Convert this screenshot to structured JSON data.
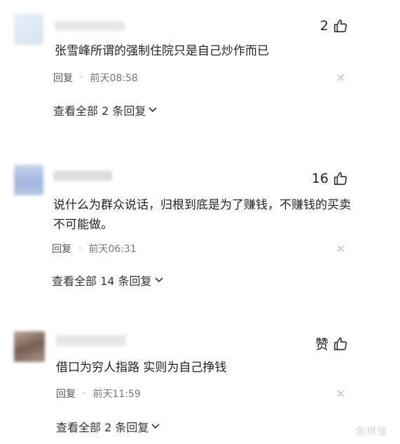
{
  "comments": [
    {
      "likes": "2",
      "text": "张雪峰所谓的强制住院只是自己炒作而已",
      "reply_label": "回复",
      "dot": "·",
      "time": "前天08:58",
      "close_glyph": "×",
      "more_label": "查看全部 2 条回复"
    },
    {
      "likes": "16",
      "text": "说什么为群众说话，归根到底是为了赚钱，不赚钱的买卖不可能做。",
      "reply_label": "回复",
      "dot": "·",
      "time": "前天06:31",
      "close_glyph": "×",
      "more_label": "查看全部 14 条回复"
    },
    {
      "likes": "赞",
      "text": "借口为穷人指路 实则为自己挣钱",
      "reply_label": "回复",
      "dot": "·",
      "time": "前天11:59",
      "close_glyph": "×",
      "more_label": "查看全部 2 条回复"
    }
  ],
  "icons": {
    "like": "thumbs-up-icon",
    "close": "close-icon",
    "expand": "chevron-down-icon"
  },
  "watermark": "象棋偃"
}
